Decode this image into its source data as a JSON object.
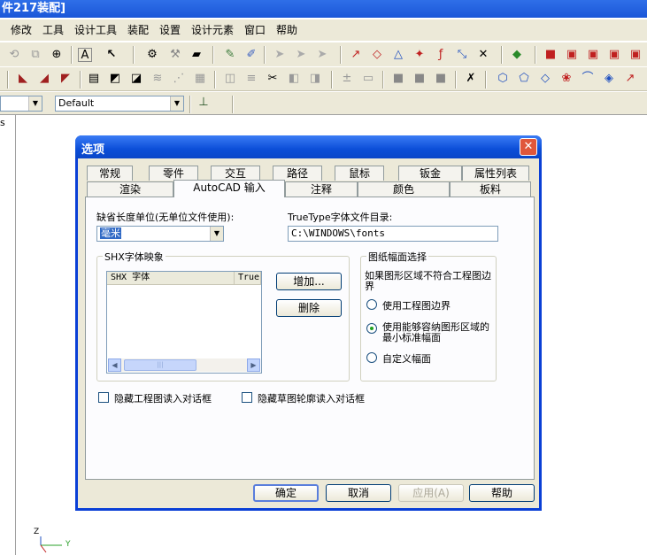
{
  "window": {
    "title": "件217装配]"
  },
  "menu": [
    "修改",
    "工具",
    "设计工具",
    "装配",
    "设置",
    "设计元素",
    "窗口",
    "帮助"
  ],
  "toolbar": {
    "style_combo": "Default"
  },
  "left_panel_text": "s",
  "dialog": {
    "title": "选项",
    "close_glyph": "✕",
    "tabs_back": [
      "常规",
      "零件",
      "交互",
      "路径",
      "鼠标",
      "钣金",
      "属性列表"
    ],
    "tabs_front": [
      "渲染",
      "AutoCAD 输入",
      "注释",
      "颜色",
      "板料"
    ],
    "active_tab": "AutoCAD 输入",
    "unit_label": "缺省长度单位(无单位文件使用):",
    "unit_value": "毫米",
    "truetype_label": "TrueType字体文件目录:",
    "truetype_path": "C:\\WINDOWS\\fonts",
    "shx_group": {
      "title": "SHX字体映象",
      "columns": [
        "SHX 字体",
        "True"
      ],
      "add_button": "增加...",
      "delete_button": "删除"
    },
    "paper_group": {
      "title": "图纸幅面选择",
      "desc": "如果图形区域不符合工程图边界",
      "options": [
        {
          "label": "使用工程图边界",
          "selected": false
        },
        {
          "label": "使用能够容纳图形区域的最小标准幅面",
          "selected": true
        },
        {
          "label": "自定义幅面",
          "selected": false
        }
      ]
    },
    "checkboxes": [
      {
        "label": "隐藏工程图读入对话框",
        "checked": false
      },
      {
        "label": "隐藏草图轮廓读入对话框",
        "checked": false
      }
    ],
    "buttons": {
      "ok": "确定",
      "cancel": "取消",
      "apply": "应用(A)",
      "help": "帮助"
    }
  },
  "axis": {
    "z": "Z",
    "y": "Y"
  }
}
